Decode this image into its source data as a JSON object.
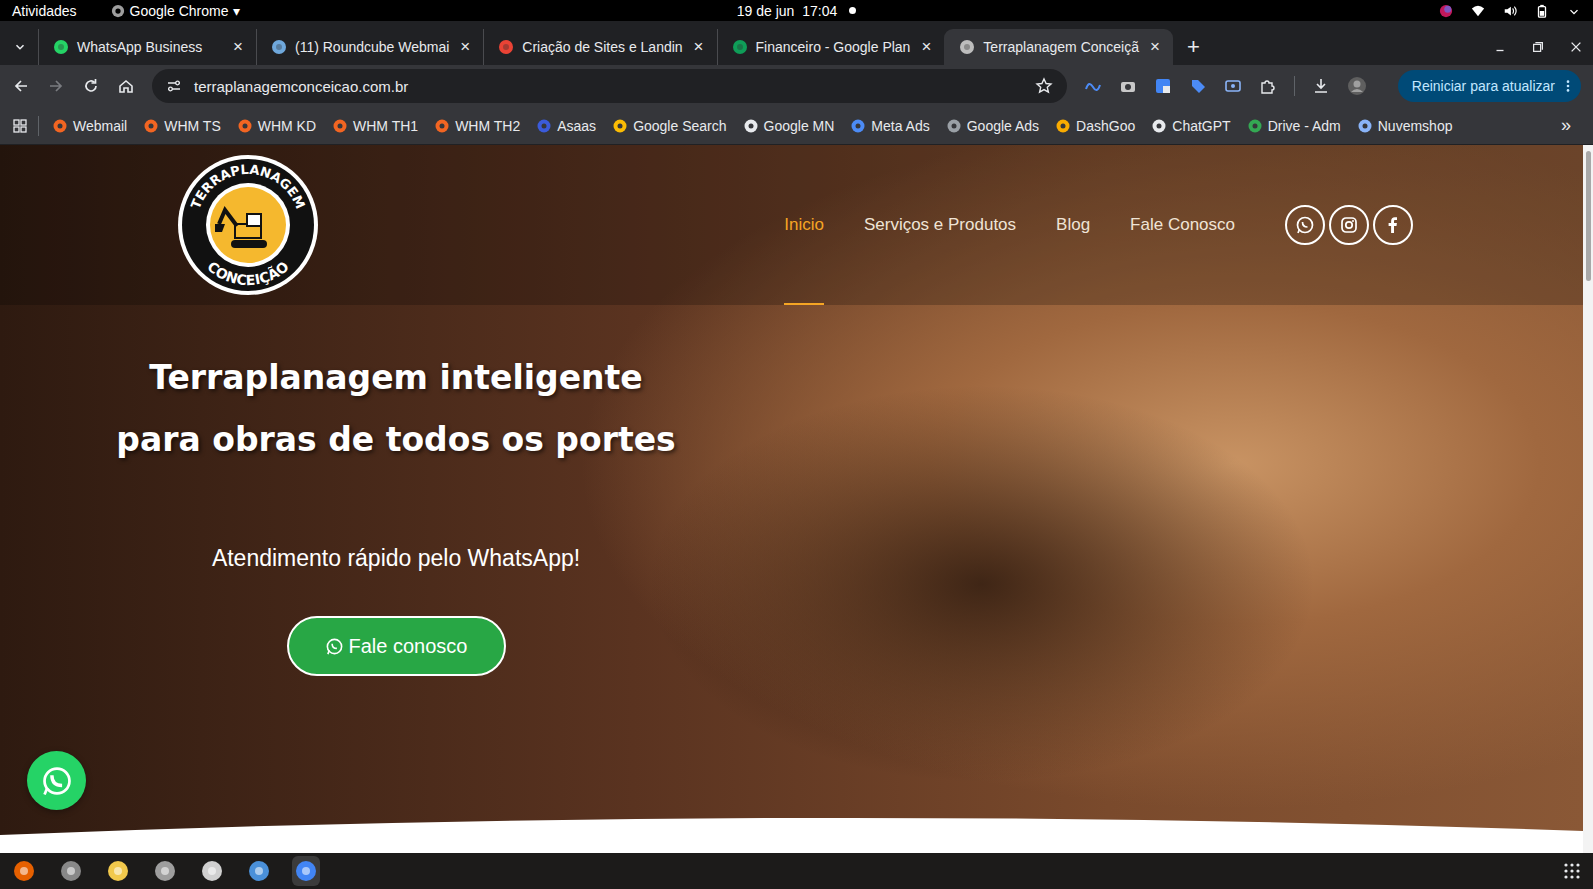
{
  "topbar": {
    "activities": "Atividades",
    "app": "Google Chrome",
    "app_arrow": "▾",
    "clock": "19 de jun  17:04"
  },
  "tabs": [
    {
      "label": "WhatsApp Business",
      "selected": false
    },
    {
      "label": "(11) Roundcube Webmai",
      "selected": false
    },
    {
      "label": "Criação de Sites e Landin",
      "selected": false
    },
    {
      "label": "Financeiro - Google Plan",
      "selected": false
    },
    {
      "label": "Terraplanagem Conceiçã",
      "selected": true
    }
  ],
  "tab_close": "×",
  "new_tab": "+",
  "address": "terraplanagemconceicao.com.br",
  "update_button": "Reiniciar para atualizar",
  "bookmarks": [
    "Webmail",
    "WHM TS",
    "WHM KD",
    "WHM TH1",
    "WHM TH2",
    "Asaas",
    "Google Search",
    "Google MN",
    "Meta Ads",
    "Google Ads",
    "DashGoo",
    "ChatGPT",
    "Drive - Adm",
    "Nuvemshop"
  ],
  "bookmarks_more": "»",
  "site": {
    "logo_top": "TERRAPLANAGEM",
    "logo_bottom": "CONCEIÇÃO",
    "nav": [
      {
        "label": "Inicio",
        "selected": true
      },
      {
        "label": "Serviços e Produtos",
        "selected": false
      },
      {
        "label": "Blog",
        "selected": false
      },
      {
        "label": "Fale Conosco",
        "selected": false
      }
    ],
    "title_lines": [
      "Terraplanagem inteligente",
      "para obras de todos os portes"
    ],
    "subtitle": "Atendimento rápido pelo WhatsApp!",
    "cta": "Fale conosco"
  }
}
